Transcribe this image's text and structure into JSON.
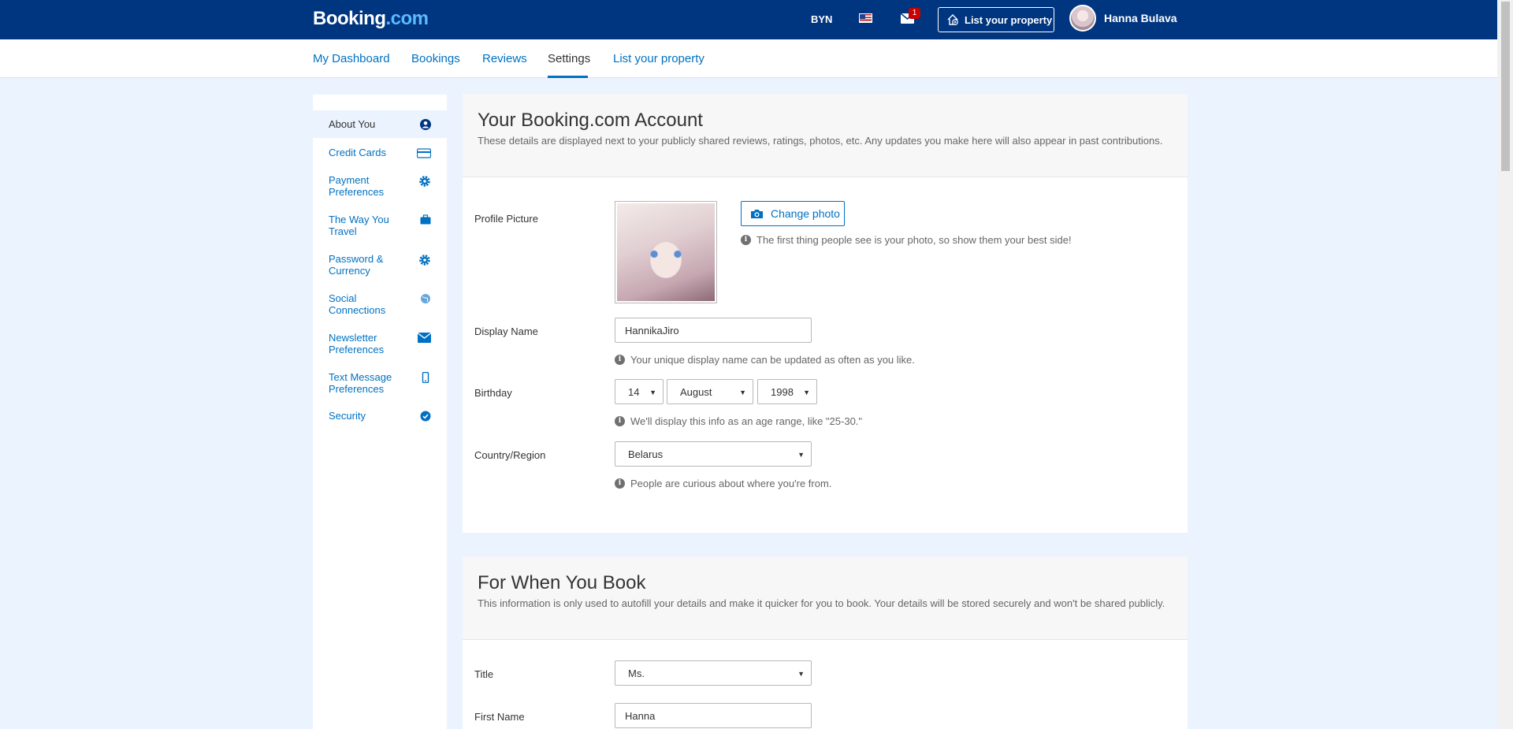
{
  "header": {
    "logo_main": "Booking",
    "logo_suffix": ".com",
    "currency": "BYN",
    "mail_badge": "1",
    "list_property_label": "List your property",
    "user_name": "Hanna Bulava"
  },
  "subnav": {
    "items": [
      {
        "label": "My Dashboard"
      },
      {
        "label": "Bookings"
      },
      {
        "label": "Reviews"
      },
      {
        "label": "Settings"
      },
      {
        "label": "List your property"
      }
    ],
    "active": "Settings"
  },
  "sidebar": {
    "items": [
      {
        "label": "About You",
        "icon": "user-icon"
      },
      {
        "label": "Credit Cards",
        "icon": "credit-card-icon"
      },
      {
        "label": "Payment\nPreferences",
        "icon": "gear-icon"
      },
      {
        "label": "The Way You\nTravel",
        "icon": "suitcase-icon"
      },
      {
        "label": "Password &\nCurrency",
        "icon": "gear-icon"
      },
      {
        "label": "Social\nConnections",
        "icon": "globe-icon"
      },
      {
        "label": "Newsletter\nPreferences",
        "icon": "envelope-icon"
      },
      {
        "label": "Text Message\nPreferences",
        "icon": "phone-icon"
      },
      {
        "label": "Security",
        "icon": "checkmark-icon"
      }
    ]
  },
  "account": {
    "title": "Your Booking.com Account",
    "description": "These details are displayed next to your publicly shared reviews, ratings, photos, etc. Any updates you make here will also appear in past contributions.",
    "profile_picture_label": "Profile Picture",
    "change_photo_label": "Change photo",
    "photo_hint": "The first thing people see is your photo, so show them your best side!",
    "display_name_label": "Display Name",
    "display_name_value": "HannikaJiro",
    "display_name_hint": "Your unique display name can be updated as often as you like.",
    "birthday_label": "Birthday",
    "birthday_day": "14",
    "birthday_month": "August",
    "birthday_year": "1998",
    "birthday_hint": "We'll display this info as an age range, like \"25-30.\"",
    "country_label": "Country/Region",
    "country_value": "Belarus",
    "country_hint": "People are curious about where you're from."
  },
  "booking": {
    "title": "For When You Book",
    "description": "This information is only used to autofill your details and make it quicker for you to book. Your details will be stored securely and won't be shared publicly.",
    "title_label": "Title",
    "title_value": "Ms.",
    "first_name_label": "First Name",
    "first_name_value": "Hanna"
  },
  "colors": {
    "brand_navy": "#003580",
    "link_blue": "#0071c2",
    "page_bg": "#ebf3ff"
  }
}
